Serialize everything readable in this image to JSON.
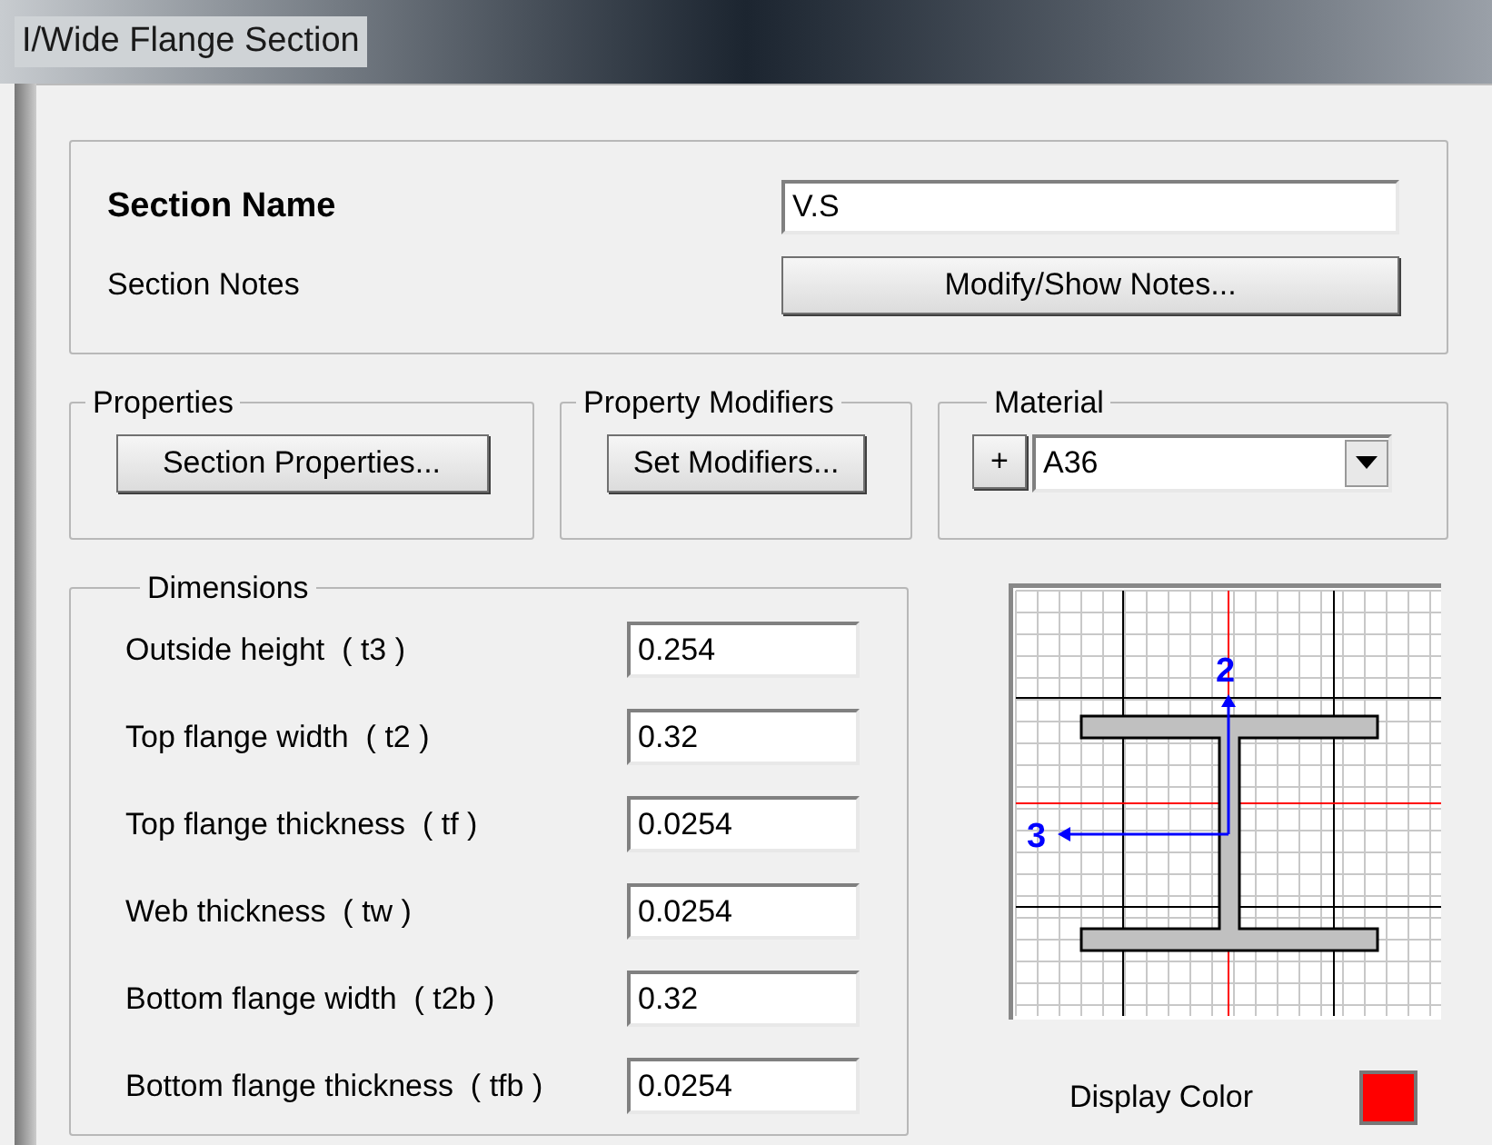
{
  "window": {
    "title": "I/Wide Flange Section"
  },
  "section_name": {
    "label": "Section Name",
    "value": "V.S"
  },
  "section_notes": {
    "label": "Section Notes",
    "button": "Modify/Show Notes..."
  },
  "properties": {
    "title": "Properties",
    "button": "Section Properties..."
  },
  "property_modifiers": {
    "title": "Property Modifiers",
    "button": "Set Modifiers..."
  },
  "material": {
    "title": "Material",
    "add_button": "+",
    "value": "A36"
  },
  "dimensions": {
    "title": "Dimensions",
    "fields": [
      {
        "label": "Outside height  ( t3 )",
        "value": "0.254"
      },
      {
        "label": "Top flange width  ( t2 )",
        "value": "0.32"
      },
      {
        "label": "Top flange thickness  ( tf )",
        "value": "0.0254"
      },
      {
        "label": "Web thickness  ( tw )",
        "value": "0.0254"
      },
      {
        "label": "Bottom flange width  ( t2b )",
        "value": "0.32"
      },
      {
        "label": "Bottom flange thickness  ( tfb )",
        "value": "0.0254"
      }
    ]
  },
  "preview": {
    "axis_2": "2",
    "axis_3": "3"
  },
  "display_color": {
    "label": "Display Color",
    "color": "#ff0000"
  }
}
